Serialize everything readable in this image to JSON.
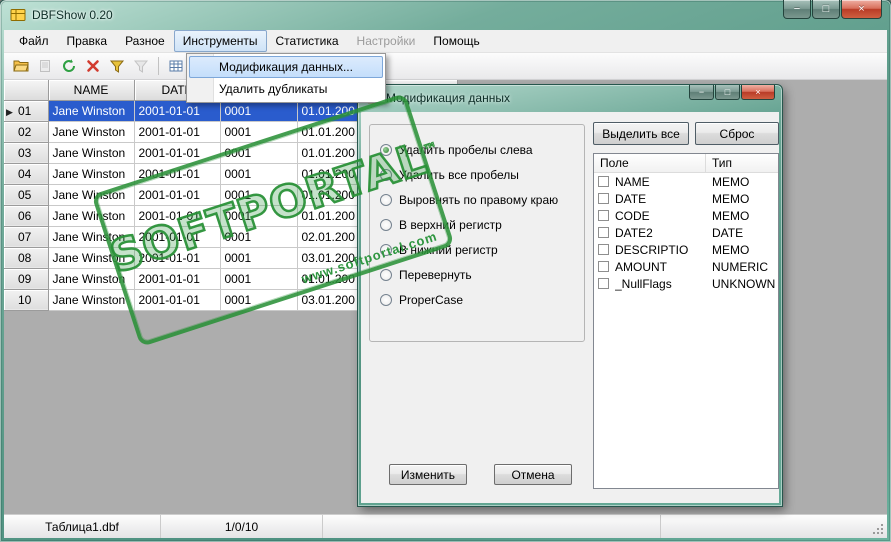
{
  "window": {
    "title": "DBFShow 0.20"
  },
  "icons": {
    "minimize": "−",
    "maximize": "□",
    "close": "×",
    "marker": "▶"
  },
  "menu": {
    "items": [
      {
        "label": "Файл",
        "enabled": true
      },
      {
        "label": "Правка",
        "enabled": true
      },
      {
        "label": "Разное",
        "enabled": true
      },
      {
        "label": "Инструменты",
        "enabled": true,
        "open": true
      },
      {
        "label": "Статистика",
        "enabled": true
      },
      {
        "label": "Настройки",
        "enabled": false
      },
      {
        "label": "Помощь",
        "enabled": true
      }
    ],
    "dropdown": {
      "items": [
        {
          "label": "Модификация данных...",
          "highlighted": true
        },
        {
          "label": "Удалить дубликаты",
          "highlighted": false
        }
      ]
    }
  },
  "toolbar": {
    "icons": [
      "open-file-icon",
      "export-icon",
      "refresh-icon",
      "delete-icon",
      "filter-icon",
      "filter-clear-icon",
      "table-structure-icon"
    ]
  },
  "table": {
    "columns": [
      "",
      "NAME",
      "DATE",
      "",
      ""
    ],
    "selected_row": 0,
    "rows": [
      {
        "num": "01",
        "name": "Jane Winston",
        "date": "2001-01-01",
        "code": "0001",
        "date2": "01.01.200"
      },
      {
        "num": "02",
        "name": "Jane Winston",
        "date": "2001-01-01",
        "code": "0001",
        "date2": "01.01.200"
      },
      {
        "num": "03",
        "name": "Jane Winston",
        "date": "2001-01-01",
        "code": "0001",
        "date2": "01.01.200"
      },
      {
        "num": "04",
        "name": "Jane Winston",
        "date": "2001-01-01",
        "code": "0001",
        "date2": "01.01.200"
      },
      {
        "num": "05",
        "name": "Jane Winston",
        "date": "2001-01-01",
        "code": "0001",
        "date2": "01.01.200"
      },
      {
        "num": "06",
        "name": "Jane Winston",
        "date": "2001-01-01",
        "code": "0001",
        "date2": "01.01.200"
      },
      {
        "num": "07",
        "name": "Jane Winston",
        "date": "2001-01-01",
        "code": "0001",
        "date2": "02.01.200"
      },
      {
        "num": "08",
        "name": "Jane Winston",
        "date": "2001-01-01",
        "code": "0001",
        "date2": "03.01.200"
      },
      {
        "num": "09",
        "name": "Jane Winston",
        "date": "2001-01-01",
        "code": "0001",
        "date2": "01.01.200"
      },
      {
        "num": "10",
        "name": "Jane Winston",
        "date": "2001-01-01",
        "code": "0001",
        "date2": "03.01.200"
      }
    ]
  },
  "dialog": {
    "title": "Модификация данных",
    "options": [
      {
        "label": "Удалить пробелы слева",
        "selected": true
      },
      {
        "label": "Удалить все пробелы",
        "selected": false
      },
      {
        "label": "Выровнять по правому краю",
        "selected": false
      },
      {
        "label": "В верхний регистр",
        "selected": false
      },
      {
        "label": "В нижний регистр",
        "selected": false
      },
      {
        "label": "Перевернуть",
        "selected": false
      },
      {
        "label": "ProperCase",
        "selected": false
      }
    ],
    "select_all_button": "Выделить все",
    "reset_button": "Сброс",
    "fields_list": {
      "columns": [
        "Поле",
        "Тип"
      ],
      "rows": [
        {
          "field": "NAME",
          "type": "MEMO",
          "checked": false
        },
        {
          "field": "DATE",
          "type": "MEMO",
          "checked": false
        },
        {
          "field": "CODE",
          "type": "MEMO",
          "checked": false
        },
        {
          "field": "DATE2",
          "type": "DATE",
          "checked": false
        },
        {
          "field": "DESCRIPTIO",
          "type": "MEMO",
          "checked": false
        },
        {
          "field": "AMOUNT",
          "type": "NUMERIC",
          "checked": false
        },
        {
          "field": "_NullFlags",
          "type": "UNKNOWN",
          "checked": false
        }
      ]
    },
    "apply_button": "Изменить",
    "cancel_button": "Отмена"
  },
  "status": {
    "file": "Таблица1.dbf",
    "position": "1/0/10"
  },
  "watermark": {
    "text": "SOFTPORTAL",
    "tm": "™",
    "subtext": "www.softportal.com",
    "color": "#2f9640"
  },
  "colors": {
    "selection": "#2a5ccd",
    "frame": "#4e9181",
    "menu_highlight": "#cde4f7"
  }
}
